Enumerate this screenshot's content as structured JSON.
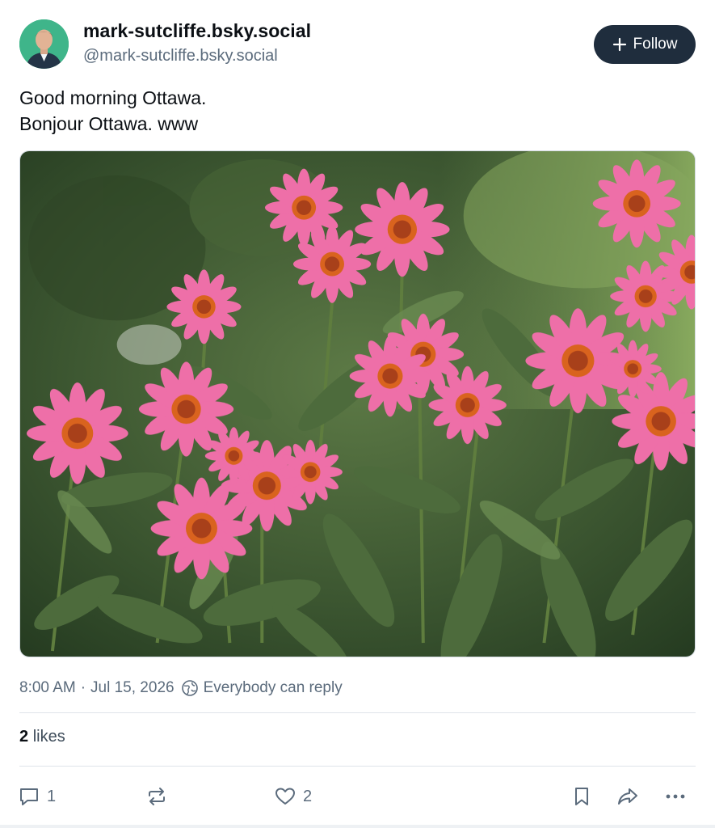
{
  "author": {
    "display_name": "mark-sutcliffe.bsky.social",
    "handle": "@mark-sutcliffe.bsky.social",
    "avatar_icon": "person-portrait-icon"
  },
  "follow_button": {
    "label": "Follow",
    "icon": "plus-icon"
  },
  "post": {
    "lines": [
      "Good morning Ottawa.",
      "Bonjour Ottawa. www"
    ],
    "image_icon": "flowers-photo"
  },
  "meta": {
    "time": "8:00 AM",
    "separator": "·",
    "date": "Jul 15, 2026",
    "reply_setting": "Everybody can reply",
    "reply_icon": "globe-icon"
  },
  "stats": {
    "likes_count": "2",
    "likes_label": "likes"
  },
  "actions": {
    "reply_count": "1",
    "like_count": "2",
    "icons": [
      "reply-icon",
      "repost-icon",
      "heart-icon",
      "bookmark-icon",
      "share-icon",
      "more-icon"
    ]
  },
  "colors": {
    "accent_dark": "#1f2d3d",
    "text_primary": "#0b0f14",
    "text_secondary": "#5b6b7c",
    "divider": "#dfe4ea",
    "petal_pink": "#ee6fa8",
    "cone_orange": "#d9631e",
    "foliage_green": "#4d6b3c"
  }
}
